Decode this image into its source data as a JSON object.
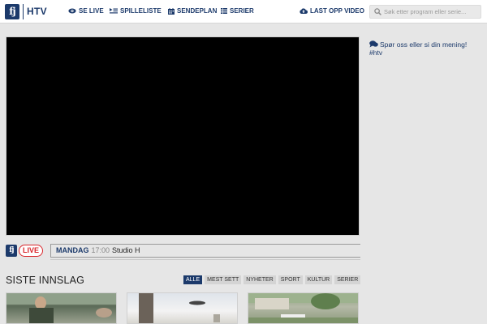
{
  "header": {
    "logo_mark": "fj",
    "logo_text": "HTV",
    "nav": [
      {
        "label": "SE LIVE",
        "icon": "eye-icon"
      },
      {
        "label": "SPILLELISTE",
        "icon": "playlist-icon"
      },
      {
        "label": "SENDEPLAN",
        "icon": "calendar-icon"
      },
      {
        "label": "SERIER",
        "icon": "list-icon"
      },
      {
        "label": "LAST OPP VIDEO",
        "icon": "cloud-upload-icon"
      }
    ],
    "search": {
      "placeholder": "Søk etter program eller serie..."
    },
    "brand_color": "#1c3a6b"
  },
  "sidebar": {
    "feedback_line1": "Spør oss eller si din mening!",
    "feedback_line2": "#htv"
  },
  "live": {
    "badge": "LIVE",
    "day": "MANDAG",
    "time": "17:00",
    "show": "Studio H",
    "badge_color": "#d9252a"
  },
  "latest": {
    "title": "SISTE INNSLAG",
    "filters": [
      "ALLE",
      "MEST SETT",
      "NYHETER",
      "SPORT",
      "KULTUR",
      "SERIER"
    ],
    "active_filter": "ALLE"
  }
}
